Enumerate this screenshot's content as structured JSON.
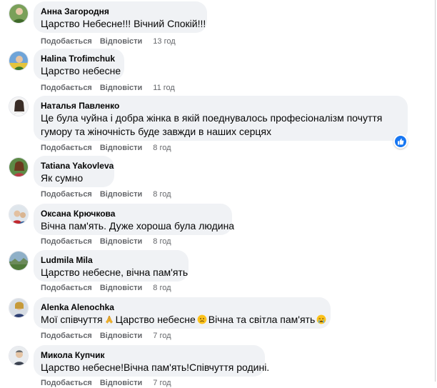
{
  "action_labels": {
    "like": "Подобається",
    "reply": "Відповісти"
  },
  "comments": [
    {
      "author": "Анна Загородня",
      "lines": [
        "Царство Небесне!!! Вічний Спокій!!!"
      ],
      "time": "13 год"
    },
    {
      "author": "Halina Trofimchuk",
      "lines": [
        "Царство небесне"
      ],
      "time": "11 год"
    },
    {
      "author": "Наталья Павленко",
      "lines": [
        "Це була чуйна і добра жінка в якій поеднувалось професіоналізм почуття",
        "гумору та жіночність буде завжди в наших серцях"
      ],
      "time": "8 год",
      "reaction": "like-icon"
    },
    {
      "author": "Tatiana Yakovleva",
      "lines": [
        "Як сумно"
      ],
      "time": "8 год"
    },
    {
      "author": "Оксана Крючкова",
      "lines": [
        "Вічна пам'ять. Дуже хороша була людина"
      ],
      "time": "8 год"
    },
    {
      "author": "Ludmila Mila",
      "lines": [
        "Царство небесне, вічна пам'ять"
      ],
      "time": "8 год"
    },
    {
      "author": "Alenka Alenochka",
      "segments": [
        "Мої співчуття",
        "Царство небесне",
        "Вічна та світла пам'ять"
      ],
      "emojis": [
        "folded-hands-icon",
        "sad-face-icon",
        "crying-face-icon"
      ],
      "time": "7 год"
    },
    {
      "author": "Микола Купчик",
      "lines": [
        "Царство небесне!Вічна пам'ять!Співчуття родині."
      ],
      "time": "7 год"
    }
  ],
  "colors": {
    "bubble": "#f0f2f5",
    "meta": "#65676b",
    "like_blue": "#1877f2"
  }
}
